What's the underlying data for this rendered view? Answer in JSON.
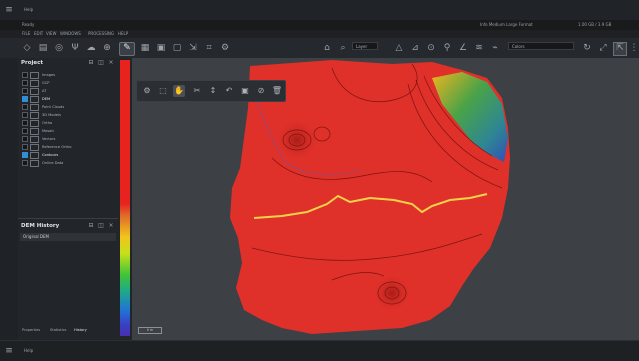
{
  "top_bar": {
    "title": "Help"
  },
  "status_bar": {
    "left": "Ready",
    "middle": "Info Medium Large Format",
    "right": "1.00 GB / 3.9 GB"
  },
  "menu": {
    "items": [
      "FILE",
      "EDIT",
      "VIEW",
      "WINDOWS",
      "PROCESSING",
      "HELP"
    ]
  },
  "toolbar": {
    "dropdown_left": "Layer",
    "dropdown_right": "Colors"
  },
  "project_panel": {
    "title": "Project",
    "layers": [
      {
        "label": "Images",
        "checked": false
      },
      {
        "label": "GCP",
        "checked": false
      },
      {
        "label": "AT",
        "checked": false
      },
      {
        "label": "DEM",
        "checked": true
      },
      {
        "label": "Point Clouds",
        "checked": false
      },
      {
        "label": "3D Models",
        "checked": false
      },
      {
        "label": "Ortho",
        "checked": false
      },
      {
        "label": "Mosaic",
        "checked": false
      },
      {
        "label": "Vectors",
        "checked": false
      },
      {
        "label": "Reference Ortho",
        "checked": false
      },
      {
        "label": "Contours",
        "checked": true
      },
      {
        "label": "Online Data",
        "checked": false
      }
    ]
  },
  "dem_history": {
    "title": "DEM History",
    "items": [
      "Original DEM"
    ]
  },
  "bottom_tabs": [
    "Properties",
    "Statistics",
    "History"
  ],
  "bottom_bar": {
    "title": "Help"
  },
  "scale": {
    "label": "0 m"
  },
  "colors": {
    "surface": "#e0302a",
    "contour": "#7a1510",
    "profile": "#f4d24a",
    "panel": "#22252a"
  }
}
